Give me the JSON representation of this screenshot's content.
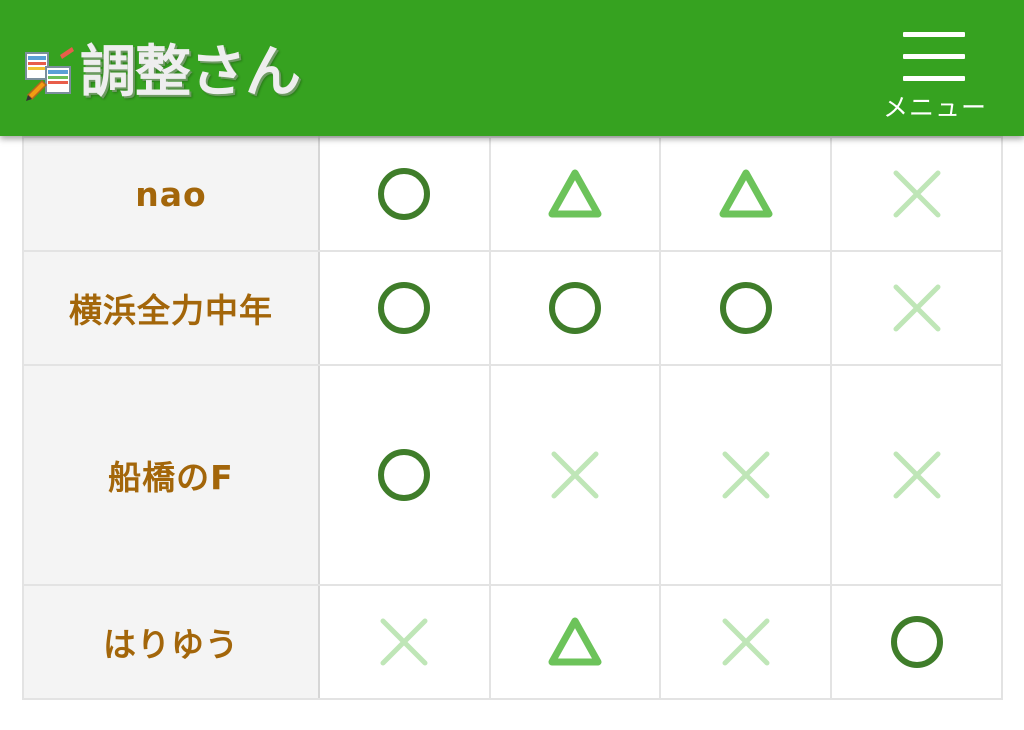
{
  "header": {
    "app_title": "調整さん",
    "menu_label": "メニュー",
    "brand_color": "#36a220"
  },
  "table": {
    "rows": [
      {
        "name": "nao",
        "marks": [
          "circle",
          "triangle",
          "triangle",
          "cross"
        ]
      },
      {
        "name": "横浜全力中年",
        "marks": [
          "circle",
          "circle",
          "circle",
          "cross"
        ]
      },
      {
        "name": "船橋のF",
        "marks": [
          "circle",
          "cross",
          "cross",
          "cross"
        ]
      },
      {
        "name": "はりゆう",
        "marks": [
          "cross",
          "triangle",
          "cross",
          "circle"
        ]
      }
    ]
  },
  "icons": {
    "circle": "circle-icon",
    "triangle": "triangle-icon",
    "cross": "cross-icon",
    "menu": "hamburger-icon"
  },
  "colors": {
    "circle": "#3f7d2a",
    "triangle": "#6cc35a",
    "cross": "#bfe6b7",
    "name_text": "#a3660a"
  }
}
